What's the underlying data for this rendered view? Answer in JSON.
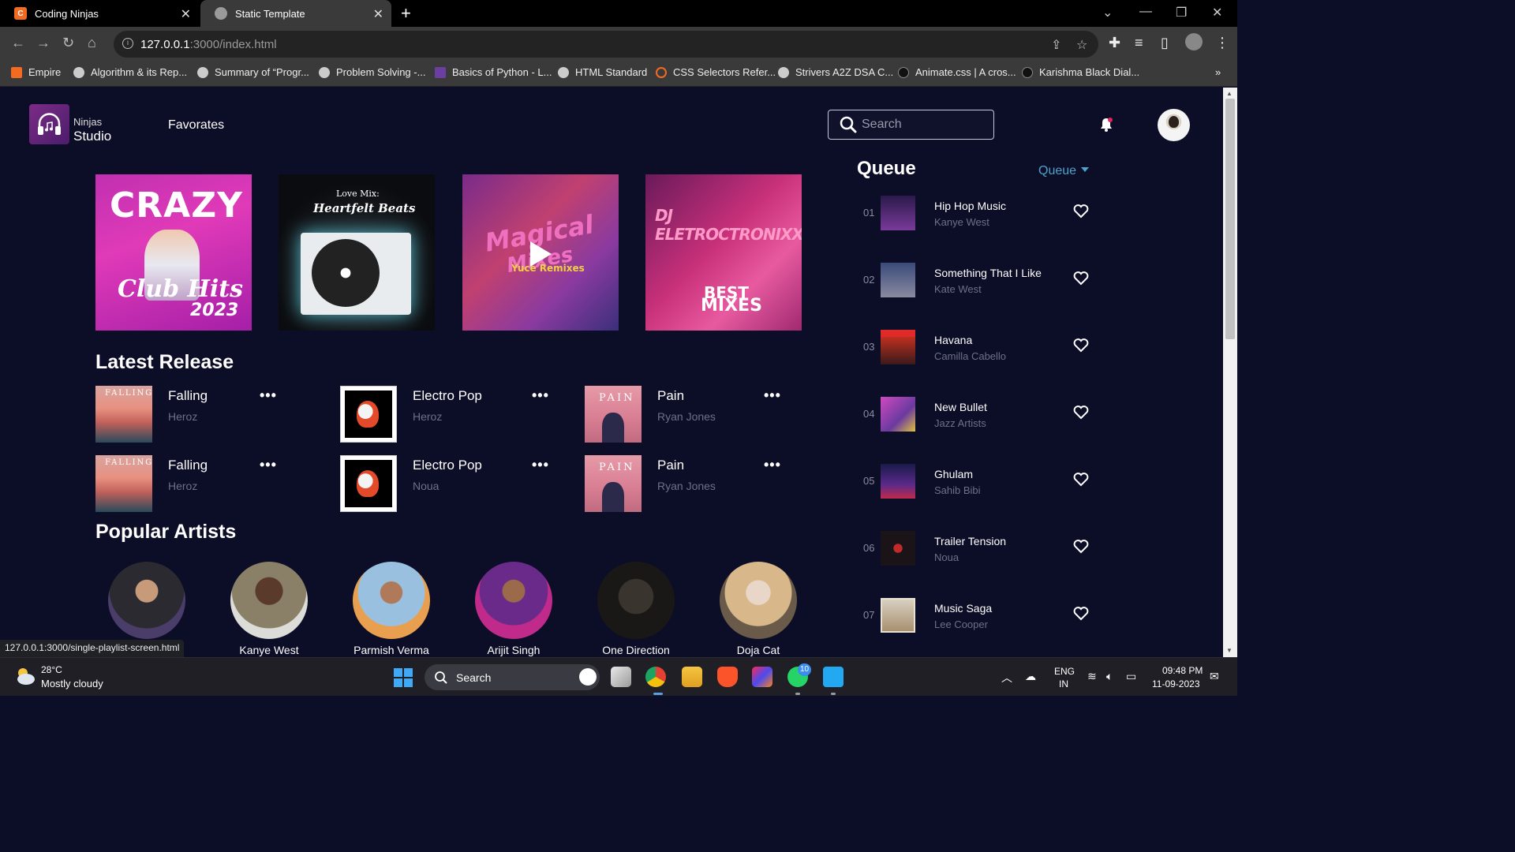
{
  "browser": {
    "tabs": [
      {
        "title": "Coding Ninjas",
        "favicon": "coding-ninjas-icon"
      },
      {
        "title": "Static Template",
        "favicon": "globe-icon"
      }
    ],
    "address": {
      "host": "127.0.0.1",
      "path": ":3000/index.html"
    },
    "bookmarks": [
      "Empire",
      "Algorithm & its Rep...",
      "Summary of “Progr...",
      "Problem Solving -...",
      "Basics of Python - L...",
      "HTML Standard",
      "CSS Selectors Refer...",
      "Strivers A2Z DSA C...",
      "Animate.css | A cros...",
      "Karishma Black Dial..."
    ],
    "status_link": "127.0.0.1:3000/single-playlist-screen.html"
  },
  "app": {
    "brand_top": "Ninjas",
    "brand_bottom": "Studio",
    "nav_favorites": "Favorates",
    "search_placeholder": "Search"
  },
  "featured": [
    {
      "name": "crazy-club-hits-cover",
      "line1": "CRAZY",
      "line2": "Club Hits",
      "line3": "2023"
    },
    {
      "name": "love-mix-heartfelt-beats-cover",
      "line1": "Love Mix:",
      "line2": "Heartfelt Beats"
    },
    {
      "name": "magical-mixes-cover",
      "line1": "Magical",
      "line2": "Mixes",
      "line3": "Yuce Remixes"
    },
    {
      "name": "dj-eletroctronixxx-cover",
      "line1": "DJ ELETROCTRONIXXX",
      "line2": "BEST",
      "line3": "MIXES"
    }
  ],
  "latest_release": {
    "title": "Latest Release",
    "items": [
      {
        "name": "Falling",
        "artist": "Heroz",
        "cover": "falling"
      },
      {
        "name": "Electro Pop",
        "artist": "Heroz",
        "cover": "electro"
      },
      {
        "name": "Pain",
        "artist": "Ryan Jones",
        "cover": "pain"
      },
      {
        "name": "Falling",
        "artist": "Heroz",
        "cover": "falling"
      },
      {
        "name": "Electro Pop",
        "artist": "Noua",
        "cover": "electro"
      },
      {
        "name": "Pain",
        "artist": "Ryan Jones",
        "cover": "pain"
      }
    ],
    "more_label": "•••"
  },
  "popular_artists": {
    "title": "Popular Artists",
    "items": [
      "",
      "Kanye West",
      "Parmish Verma",
      "Arijit Singh",
      "One Direction",
      "Doja Cat"
    ]
  },
  "queue": {
    "title": "Queue",
    "dropdown": "Queue",
    "items": [
      {
        "num": "01",
        "name": "Hip Hop Music",
        "artist": "Kanye West"
      },
      {
        "num": "02",
        "name": "Something That I Like",
        "artist": "Kate West"
      },
      {
        "num": "03",
        "name": "Havana",
        "artist": "Camilla Cabello"
      },
      {
        "num": "04",
        "name": "New Bullet",
        "artist": "Jazz Artists"
      },
      {
        "num": "05",
        "name": "Ghulam",
        "artist": "Sahib Bibi"
      },
      {
        "num": "06",
        "name": "Trailer Tension",
        "artist": "Noua"
      },
      {
        "num": "07",
        "name": "Music Saga",
        "artist": "Lee Cooper"
      }
    ]
  },
  "taskbar": {
    "weather_temp": "28°C",
    "weather_desc": "Mostly cloudy",
    "search": "Search",
    "whatsapp_badge": "10",
    "lang_top": "ENG",
    "lang_bottom": "IN",
    "time": "09:48 PM",
    "date": "11-09-2023"
  },
  "colors": {
    "page_bg": "#0c0d26",
    "accent": "#4da3c9",
    "muted_text": "#6f7088"
  }
}
